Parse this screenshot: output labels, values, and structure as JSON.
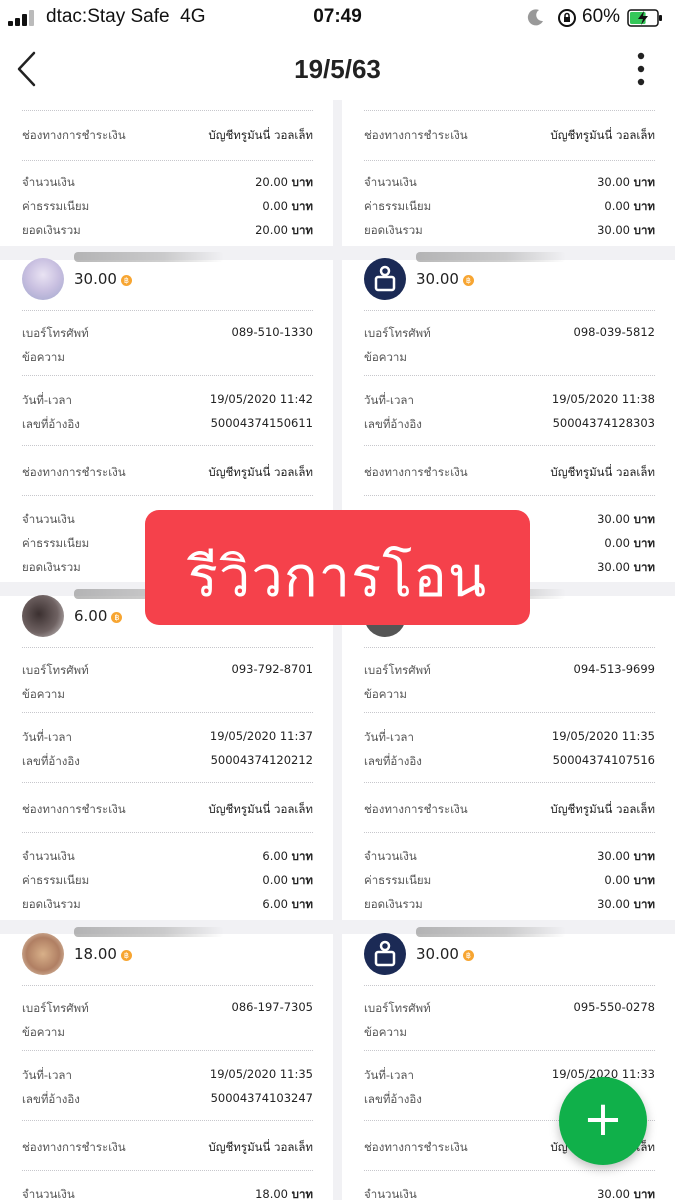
{
  "status_bar": {
    "carrier": "dtac:Stay Safe",
    "network": "4G",
    "time": "07:49",
    "battery": "60%",
    "battery_level": 0.6
  },
  "nav": {
    "title": "19/5/63"
  },
  "labels": {
    "channel": "ช่องทางการชำระเงิน",
    "amount": "จำนวนเงิน",
    "fee": "ค่าธรรมเนียม",
    "total": "ยอดเงินรวม",
    "phone": "เบอร์โทรศัพท์",
    "message": "ข้อความ",
    "datetime": "วันที่-เวลา",
    "ref": "เลขที่อ้างอิง",
    "unit": "บาท",
    "wallet": "บัญชีทรูมันนี่ วอลเล็ท"
  },
  "overlay": {
    "text": "รีวิวการโอน"
  },
  "fab": {
    "label": "+"
  },
  "columns": {
    "left": {
      "top_block": {
        "amount": "20.00",
        "fee": "0.00",
        "total": "20.00"
      },
      "records": [
        {
          "amount_head": "30.00",
          "phone": "089-510-1330",
          "datetime": "19/05/2020 11:42",
          "ref": "50004374150611",
          "amount": "",
          "fee": "",
          "total": ""
        },
        {
          "amount_head": "6.00",
          "phone": "093-792-8701",
          "datetime": "19/05/2020 11:37",
          "ref": "50004374120212",
          "amount": "6.00",
          "fee": "0.00",
          "total": "6.00"
        },
        {
          "amount_head": "18.00",
          "phone": "086-197-7305",
          "datetime": "19/05/2020 11:35",
          "ref": "50004374103247",
          "amount": "18.00"
        }
      ]
    },
    "right": {
      "top_block": {
        "amount": "30.00",
        "fee": "0.00",
        "total": "30.00"
      },
      "records": [
        {
          "amount_head": "30.00",
          "phone": "098-039-5812",
          "datetime": "19/05/2020 11:38",
          "ref": "50004374128303",
          "amount": "30.00",
          "fee": "0.00",
          "total": "30.00"
        },
        {
          "amount_head": "",
          "phone": "094-513-9699",
          "datetime": "19/05/2020 11:35",
          "ref": "50004374107516",
          "amount": "30.00",
          "fee": "0.00",
          "total": "30.00"
        },
        {
          "amount_head": "30.00",
          "phone": "095-550-0278",
          "datetime": "19/05/2020 11:33",
          "ref": "",
          "amount": "30.00"
        }
      ]
    }
  }
}
